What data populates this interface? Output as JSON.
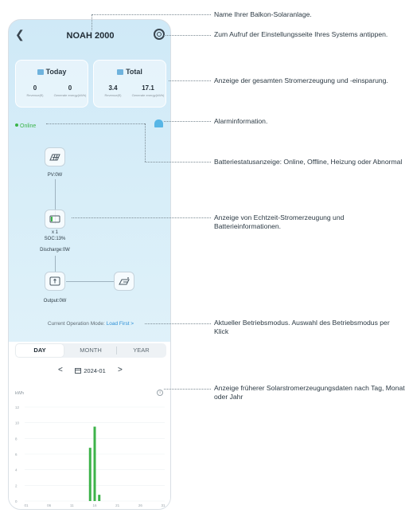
{
  "header": {
    "title": "NOAH 2000",
    "back_icon": "chevron-left-icon",
    "settings_icon": "gear-icon"
  },
  "cards": {
    "today": {
      "title": "Today",
      "revenue": "0",
      "revenue_label": "Revenue(€)",
      "energy": "0",
      "energy_label": "Generate energy(kWh)"
    },
    "total": {
      "title": "Total",
      "revenue": "3.4",
      "revenue_label": "Revenue(€)",
      "energy": "17.1",
      "energy_label": "Generate energy(kWh)"
    }
  },
  "status": {
    "online": "Online",
    "online_color": "#3bb54a"
  },
  "flow": {
    "pv": "PV:0W",
    "battery_count": "x 1",
    "soc": "SOC:13%",
    "discharge": "Discharge:0W",
    "output": "Output:0W"
  },
  "mode": {
    "label": "Current Operation Mode:",
    "value": "Load First >"
  },
  "tabs": [
    "DAY",
    "MONTH",
    "YEAR"
  ],
  "date": {
    "value": "2024-01",
    "prev": "<",
    "next": ">"
  },
  "chart_data": {
    "type": "bar",
    "ylabel": "kWh",
    "ylim": [
      0,
      12
    ],
    "y_ticks": [
      0,
      2,
      4,
      6,
      8,
      10,
      12
    ],
    "x_ticks": [
      "01",
      "06",
      "11",
      "16",
      "21",
      "26",
      "31"
    ],
    "x": [
      15,
      16,
      17
    ],
    "values": [
      6.8,
      9.5,
      0.8
    ],
    "color": "#3db34a"
  },
  "annotations": [
    "Name Ihrer Balkon-Solaranlage.",
    "Zum Aufruf der Einstellungsseite Ihres Systems antippen.",
    "Anzeige der gesamten Stromerzeugung und -einsparung.",
    "Alarminformation.",
    "Batteriestatusanzeige: Online, Offline, Heizung oder Abnormal",
    "Anzeige von Echtzeit-Stromerzeugung und Batterieinformationen.",
    "Aktueller Betriebsmodus. Auswahl des Betriebsmodus per Klick",
    "Anzeige früherer Solarstromerzeugungsdaten nach Tag, Monat oder Jahr"
  ]
}
